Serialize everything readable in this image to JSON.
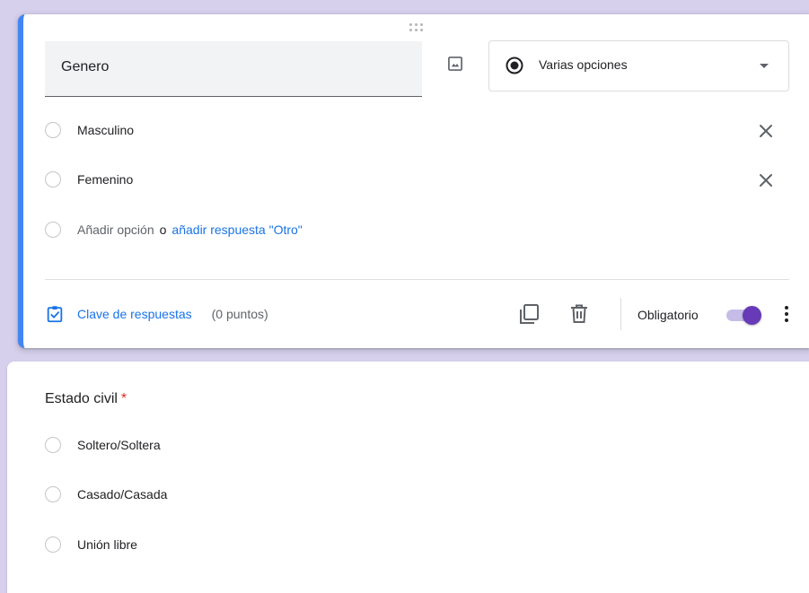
{
  "question_editor": {
    "title": "Genero",
    "type_select": {
      "selected": "Varias opciones",
      "icon": "radio-button-checked-icon"
    },
    "options": [
      {
        "label": "Masculino"
      },
      {
        "label": "Femenino"
      }
    ],
    "add_option": {
      "placeholder": "Añadir opción",
      "conjunction": "o",
      "other_link": "añadir respuesta \"Otro\""
    },
    "footer": {
      "answer_key_label": "Clave de respuestas",
      "points": "(0 puntos)",
      "required_label": "Obligatorio",
      "required_on": true
    }
  },
  "question_static": {
    "title": "Estado civil",
    "required_mark": "*",
    "options": [
      {
        "label": "Soltero/Soltera"
      },
      {
        "label": "Casado/Casada"
      },
      {
        "label": "Unión libre"
      }
    ]
  },
  "colors": {
    "accent": "#673ab7",
    "focus_bar": "#4285f4",
    "link": "#1a73e8",
    "page_bg": "#d6d0ec",
    "required": "#d93025"
  }
}
